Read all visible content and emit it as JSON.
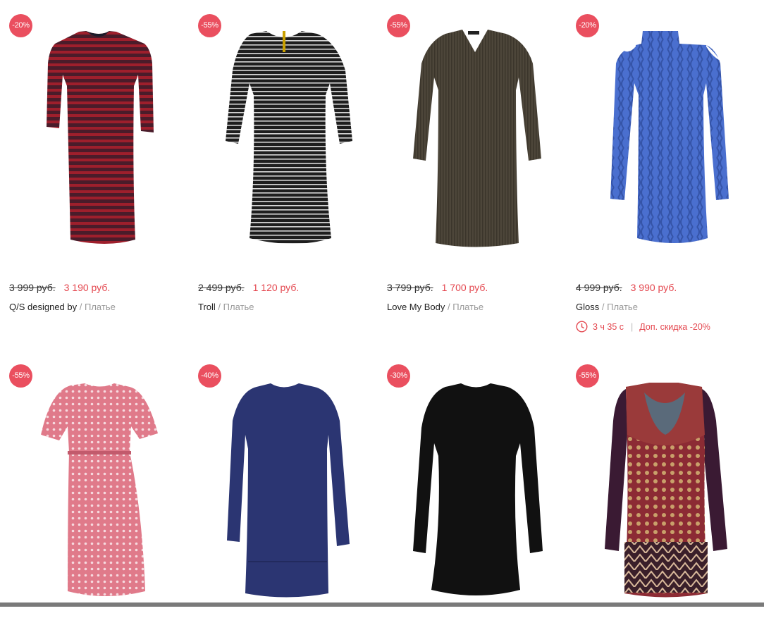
{
  "products": [
    {
      "badge": "-20%",
      "old_price": "3 999 руб.",
      "new_price": "3 190 руб.",
      "brand": "Q/S designed by",
      "category": "Платье",
      "image": "red-striped-dress"
    },
    {
      "badge": "-55%",
      "old_price": "2 499 руб.",
      "new_price": "1 120 руб.",
      "brand": "Troll",
      "category": "Платье",
      "image": "black-white-striped-dress"
    },
    {
      "badge": "-55%",
      "old_price": "3 799 руб.",
      "new_price": "1 700 руб.",
      "brand": "Love My Body",
      "category": "Платье",
      "image": "olive-knit-dress"
    },
    {
      "badge": "-20%",
      "old_price": "4 999 руб.",
      "new_price": "3 990 руб.",
      "brand": "Gloss",
      "category": "Платье",
      "image": "blue-cable-knit-dress",
      "timer": "3 ч 35 с",
      "extra_discount": "Доп. скидка -20%"
    },
    {
      "badge": "-55%",
      "image": "pink-print-dress"
    },
    {
      "badge": "-40%",
      "image": "navy-dress"
    },
    {
      "badge": "-30%",
      "image": "black-dress"
    },
    {
      "badge": "-55%",
      "image": "printed-long-sleeve-dress"
    }
  ],
  "separator": "/",
  "colors": {
    "badge": "#ea4f5f",
    "sale_price": "#e4474f",
    "muted": "#999999"
  }
}
